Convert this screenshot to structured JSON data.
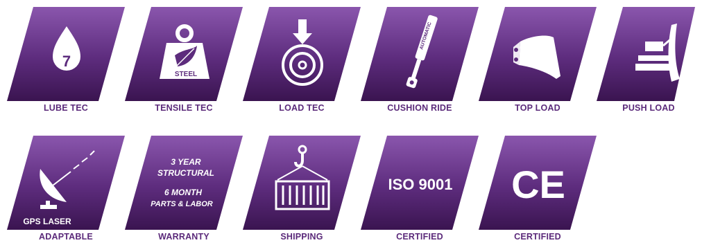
{
  "features": [
    {
      "icon": "drop-icon",
      "badge_text": "7",
      "caption": "LUBE TEC"
    },
    {
      "icon": "steel-weight-icon",
      "badge_text": "STEEL",
      "caption": "TENSILE TEC"
    },
    {
      "icon": "load-bearing-icon",
      "caption": "LOAD TEC"
    },
    {
      "icon": "cylinder-icon",
      "badge_text": "AUTOMATIC",
      "caption": "CUSHION RIDE"
    },
    {
      "icon": "bucket-icon",
      "caption": "TOP LOAD"
    },
    {
      "icon": "push-blade-icon",
      "caption": "PUSH LOAD"
    },
    {
      "icon": "satellite-dish-icon",
      "badge_text": "GPS LASER",
      "caption": "ADAPTABLE"
    },
    {
      "icon": "warranty-text-icon",
      "badge_lines": [
        "3 YEAR",
        "STRUCTURAL",
        "6 MONTH",
        "PARTS & LABOR"
      ],
      "caption": "WARRANTY"
    },
    {
      "icon": "container-hook-icon",
      "caption": "SHIPPING"
    },
    {
      "icon": "iso-icon",
      "badge_text": "ISO 9001",
      "caption": "CERTIFIED"
    },
    {
      "icon": "ce-mark-icon",
      "badge_text": "CE",
      "caption": "CERTIFIED"
    }
  ],
  "colors": {
    "badge_top": "#8a56ad",
    "badge_bottom": "#3a1450",
    "caption": "#5b2a7a"
  }
}
